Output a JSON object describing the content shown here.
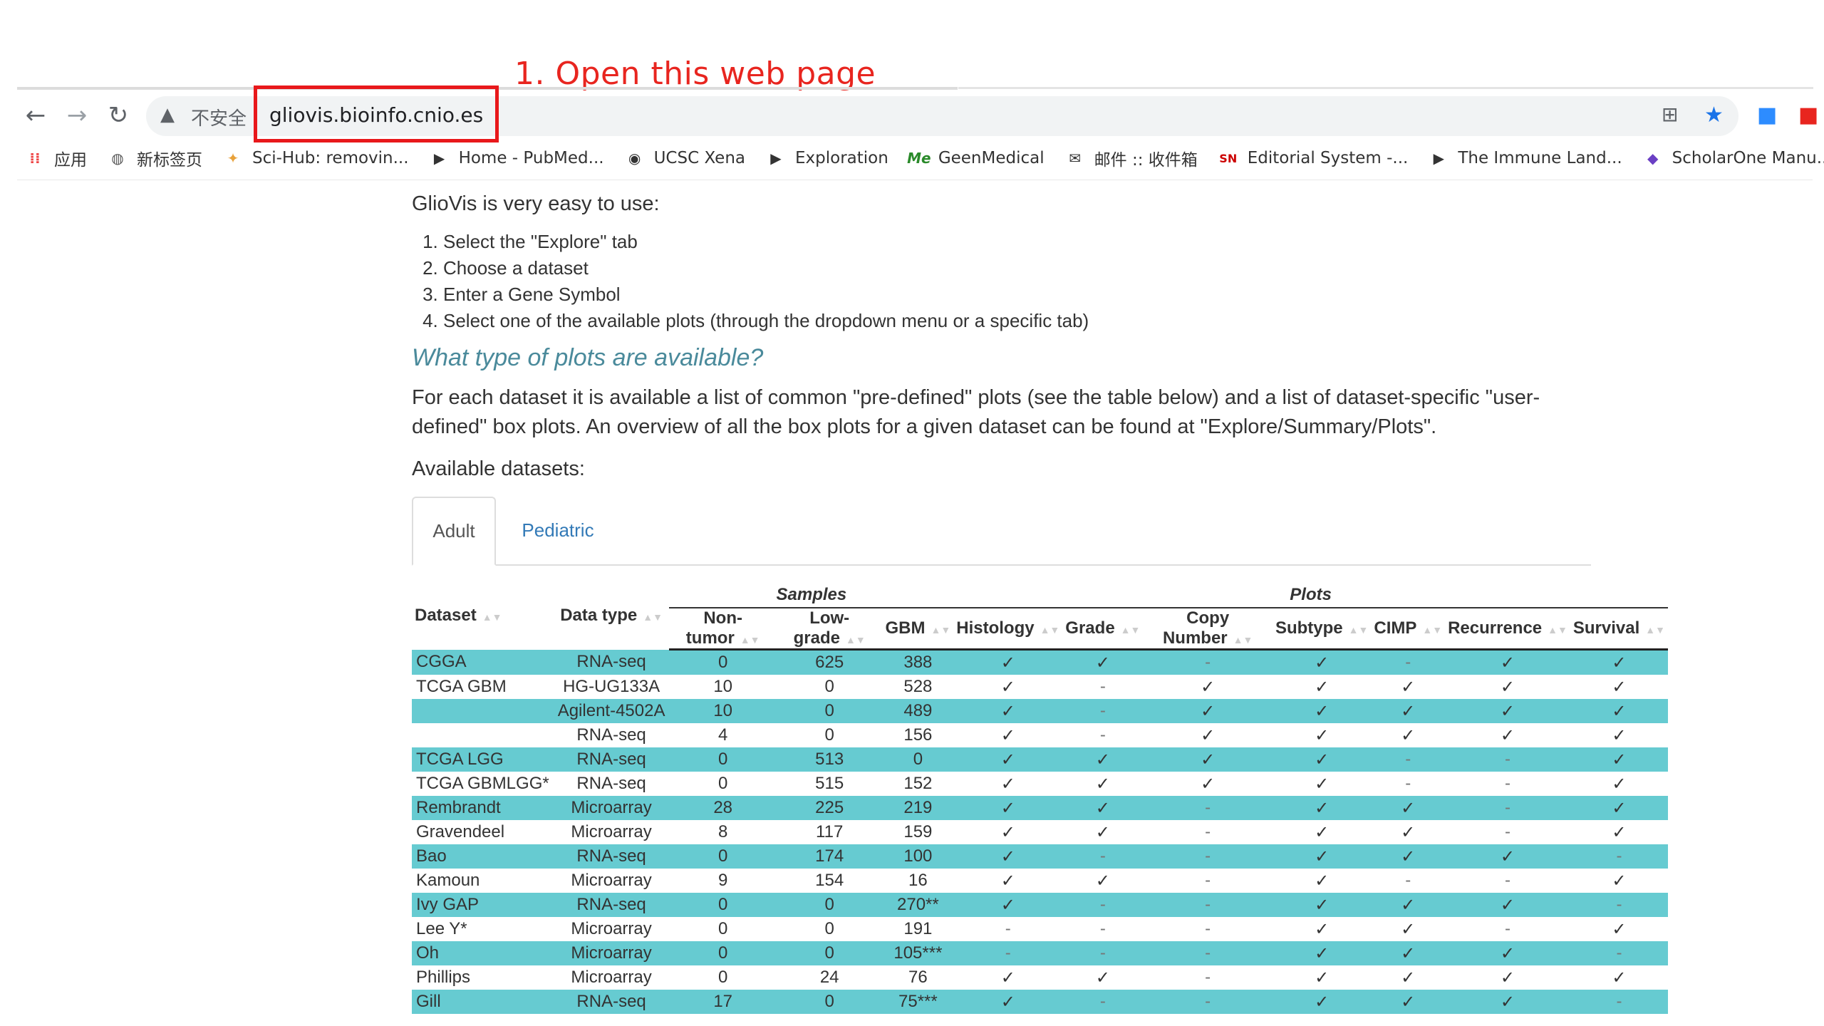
{
  "annotation": {
    "text": "1. Open this web page"
  },
  "browser": {
    "not_secure_label": "不安全",
    "url": "gliovis.bioinfo.cnio.es",
    "bookmarks": [
      {
        "label": "应用",
        "icon": "apps-grid-icon"
      },
      {
        "label": "新标签页",
        "icon": "globe-icon"
      },
      {
        "label": "Sci-Hub: removin...",
        "icon": "raven-icon"
      },
      {
        "label": "Home - PubMed...",
        "icon": "pubmed-icon"
      },
      {
        "label": "UCSC Xena",
        "icon": "xena-icon"
      },
      {
        "label": "Exploration",
        "icon": "pubmed-icon"
      },
      {
        "label": "GeenMedical",
        "icon": "me-icon"
      },
      {
        "label": "邮件 :: 收件箱",
        "icon": "mail-icon"
      },
      {
        "label": "Editorial System -...",
        "icon": "sn-icon"
      },
      {
        "label": "The Immune Land...",
        "icon": "pubmed-icon"
      },
      {
        "label": "ScholarOne Manu...",
        "icon": "scholarone-icon"
      }
    ]
  },
  "page": {
    "intro": "GlioVis is very easy to use:",
    "steps": [
      "Select the \"Explore\" tab",
      "Choose a dataset",
      "Enter a Gene Symbol",
      "Select one of the available plots (through the dropdown menu or a specific tab)"
    ],
    "heading": "What type of plots are available?",
    "paragraph": "For each dataset it is available a list of common \"pre-defined\" plots (see the table below) and a list of dataset-specific \"user-defined\" box plots. An overview of all the box plots for a given dataset can be found at \"Explore/Summary/Plots\".",
    "available_label": "Available datasets:",
    "tabs": [
      "Adult",
      "Pediatric"
    ]
  },
  "table": {
    "group_headers": {
      "samples": "Samples",
      "plots": "Plots"
    },
    "col_headers": [
      "Dataset",
      "Data type",
      "Non-tumor",
      "Low-grade",
      "GBM",
      "Histology",
      "Grade",
      "Copy Number",
      "Subtype",
      "CIMP",
      "Recurrence",
      "Survival"
    ],
    "rows": [
      [
        "CGGA",
        "RNA-seq",
        "0",
        "625",
        "388",
        "✓",
        "✓",
        "-",
        "✓",
        "-",
        "✓",
        "✓"
      ],
      [
        "TCGA GBM",
        "HG-UG133A",
        "10",
        "0",
        "528",
        "✓",
        "-",
        "✓",
        "✓",
        "✓",
        "✓",
        "✓"
      ],
      [
        "",
        "Agilent-4502A",
        "10",
        "0",
        "489",
        "✓",
        "-",
        "✓",
        "✓",
        "✓",
        "✓",
        "✓"
      ],
      [
        "",
        "RNA-seq",
        "4",
        "0",
        "156",
        "✓",
        "-",
        "✓",
        "✓",
        "✓",
        "✓",
        "✓"
      ],
      [
        "TCGA LGG",
        "RNA-seq",
        "0",
        "513",
        "0",
        "✓",
        "✓",
        "✓",
        "✓",
        "-",
        "-",
        "✓"
      ],
      [
        "TCGA GBMLGG*",
        "RNA-seq",
        "0",
        "515",
        "152",
        "✓",
        "✓",
        "✓",
        "✓",
        "-",
        "-",
        "✓"
      ],
      [
        "Rembrandt",
        "Microarray",
        "28",
        "225",
        "219",
        "✓",
        "✓",
        "-",
        "✓",
        "✓",
        "-",
        "✓"
      ],
      [
        "Gravendeel",
        "Microarray",
        "8",
        "117",
        "159",
        "✓",
        "✓",
        "-",
        "✓",
        "✓",
        "-",
        "✓"
      ],
      [
        "Bao",
        "RNA-seq",
        "0",
        "174",
        "100",
        "✓",
        "-",
        "-",
        "✓",
        "✓",
        "✓",
        "-"
      ],
      [
        "Kamoun",
        "Microarray",
        "9",
        "154",
        "16",
        "✓",
        "✓",
        "-",
        "✓",
        "-",
        "-",
        "✓"
      ],
      [
        "Ivy GAP",
        "RNA-seq",
        "0",
        "0",
        "270**",
        "✓",
        "-",
        "-",
        "✓",
        "✓",
        "✓",
        "-"
      ],
      [
        "Lee Y*",
        "Microarray",
        "0",
        "0",
        "191",
        "-",
        "-",
        "-",
        "✓",
        "✓",
        "-",
        "✓"
      ],
      [
        "Oh",
        "Microarray",
        "0",
        "0",
        "105***",
        "-",
        "-",
        "-",
        "✓",
        "✓",
        "✓",
        "-"
      ],
      [
        "Phillips",
        "Microarray",
        "0",
        "24",
        "76",
        "✓",
        "✓",
        "-",
        "✓",
        "✓",
        "✓",
        "✓"
      ],
      [
        "Gill",
        "RNA-seq",
        "17",
        "0",
        "75***",
        "✓",
        "-",
        "-",
        "✓",
        "✓",
        "✓",
        "-"
      ]
    ]
  }
}
